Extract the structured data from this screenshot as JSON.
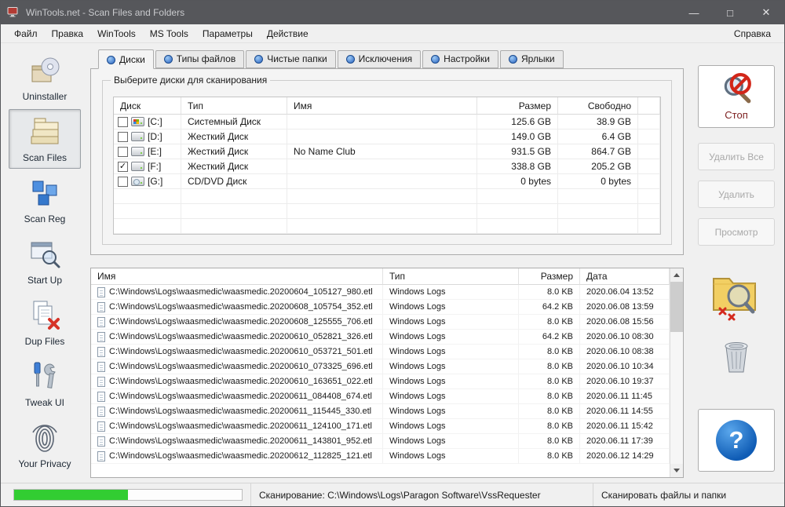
{
  "window": {
    "title": "WinTools.net - Scan Files and Folders",
    "controls": {
      "minimize": "—",
      "maximize": "□",
      "close": "✕"
    }
  },
  "menu": {
    "items": [
      "Файл",
      "Правка",
      "WinTools",
      "MS Tools",
      "Параметры",
      "Действие"
    ],
    "help": "Справка"
  },
  "sidebar": {
    "items": [
      {
        "label": "Uninstaller",
        "icon": "uninstaller-icon",
        "selected": false
      },
      {
        "label": "Scan Files",
        "icon": "scan-files-icon",
        "selected": true
      },
      {
        "label": "Scan Reg",
        "icon": "scan-reg-icon",
        "selected": false
      },
      {
        "label": "Start Up",
        "icon": "start-up-icon",
        "selected": false
      },
      {
        "label": "Dup Files",
        "icon": "dup-files-icon",
        "selected": false
      },
      {
        "label": "Tweak UI",
        "icon": "tweak-ui-icon",
        "selected": false
      },
      {
        "label": "Your Privacy",
        "icon": "your-privacy-icon",
        "selected": false
      }
    ]
  },
  "tabs": [
    {
      "label": "Диски",
      "selected": true
    },
    {
      "label": "Типы файлов",
      "selected": false
    },
    {
      "label": "Чистые папки",
      "selected": false
    },
    {
      "label": "Исключения",
      "selected": false
    },
    {
      "label": "Настройки",
      "selected": false
    },
    {
      "label": "Ярлыки",
      "selected": false
    }
  ],
  "drives_panel": {
    "group_title": "Выберите диски для сканирования",
    "columns": [
      "Диск",
      "Тип",
      "Имя",
      "Размер",
      "Свободно"
    ],
    "rows": [
      {
        "checked": false,
        "drive": "[C:]",
        "type": "Системный Диск",
        "name": "",
        "size": "125.6 GB",
        "free": "38.9 GB",
        "icon": "system-drive"
      },
      {
        "checked": false,
        "drive": "[D:]",
        "type": "Жесткий Диск",
        "name": "",
        "size": "149.0 GB",
        "free": "6.4 GB",
        "icon": "hard-drive"
      },
      {
        "checked": false,
        "drive": "[E:]",
        "type": "Жесткий Диск",
        "name": "No Name Club",
        "size": "931.5 GB",
        "free": "864.7 GB",
        "icon": "hard-drive"
      },
      {
        "checked": true,
        "drive": "[F:]",
        "type": "Жесткий Диск",
        "name": "",
        "size": "338.8 GB",
        "free": "205.2 GB",
        "icon": "hard-drive"
      },
      {
        "checked": false,
        "drive": "[G:]",
        "type": "CD/DVD Диск",
        "name": "",
        "size": "0 bytes",
        "free": "0 bytes",
        "icon": "cd-drive"
      }
    ]
  },
  "files_panel": {
    "columns": [
      "Имя",
      "Тип",
      "Размер",
      "Дата"
    ],
    "rows": [
      {
        "name": "C:\\Windows\\Logs\\waasmedic\\waasmedic.20200604_105127_980.etl",
        "type": "Windows Logs",
        "size": "8.0 KB",
        "date": "2020.06.04 13:52"
      },
      {
        "name": "C:\\Windows\\Logs\\waasmedic\\waasmedic.20200608_105754_352.etl",
        "type": "Windows Logs",
        "size": "64.2 KB",
        "date": "2020.06.08 13:59"
      },
      {
        "name": "C:\\Windows\\Logs\\waasmedic\\waasmedic.20200608_125555_706.etl",
        "type": "Windows Logs",
        "size": "8.0 KB",
        "date": "2020.06.08 15:56"
      },
      {
        "name": "C:\\Windows\\Logs\\waasmedic\\waasmedic.20200610_052821_326.etl",
        "type": "Windows Logs",
        "size": "64.2 KB",
        "date": "2020.06.10 08:30"
      },
      {
        "name": "C:\\Windows\\Logs\\waasmedic\\waasmedic.20200610_053721_501.etl",
        "type": "Windows Logs",
        "size": "8.0 KB",
        "date": "2020.06.10 08:38"
      },
      {
        "name": "C:\\Windows\\Logs\\waasmedic\\waasmedic.20200610_073325_696.etl",
        "type": "Windows Logs",
        "size": "8.0 KB",
        "date": "2020.06.10 10:34"
      },
      {
        "name": "C:\\Windows\\Logs\\waasmedic\\waasmedic.20200610_163651_022.etl",
        "type": "Windows Logs",
        "size": "8.0 KB",
        "date": "2020.06.10 19:37"
      },
      {
        "name": "C:\\Windows\\Logs\\waasmedic\\waasmedic.20200611_084408_674.etl",
        "type": "Windows Logs",
        "size": "8.0 KB",
        "date": "2020.06.11 11:45"
      },
      {
        "name": "C:\\Windows\\Logs\\waasmedic\\waasmedic.20200611_115445_330.etl",
        "type": "Windows Logs",
        "size": "8.0 KB",
        "date": "2020.06.11 14:55"
      },
      {
        "name": "C:\\Windows\\Logs\\waasmedic\\waasmedic.20200611_124100_171.etl",
        "type": "Windows Logs",
        "size": "8.0 KB",
        "date": "2020.06.11 15:42"
      },
      {
        "name": "C:\\Windows\\Logs\\waasmedic\\waasmedic.20200611_143801_952.etl",
        "type": "Windows Logs",
        "size": "8.0 KB",
        "date": "2020.06.11 17:39"
      },
      {
        "name": "C:\\Windows\\Logs\\waasmedic\\waasmedic.20200612_112825_121.etl",
        "type": "Windows Logs",
        "size": "8.0 KB",
        "date": "2020.06.12 14:29"
      }
    ]
  },
  "actions": {
    "stop": "Стоп",
    "delete_all": "Удалить Все",
    "delete": "Удалить",
    "preview": "Просмотр",
    "help": "?"
  },
  "statusbar": {
    "progress_percent": 50,
    "scanning": "Сканирование: C:\\Windows\\Logs\\Paragon Software\\VssRequester",
    "mode": "Сканировать файлы и папки"
  },
  "colors": {
    "progress_green": "#32cd32",
    "titlebar": "#56575b",
    "help_blue": "#0f5cb5"
  }
}
